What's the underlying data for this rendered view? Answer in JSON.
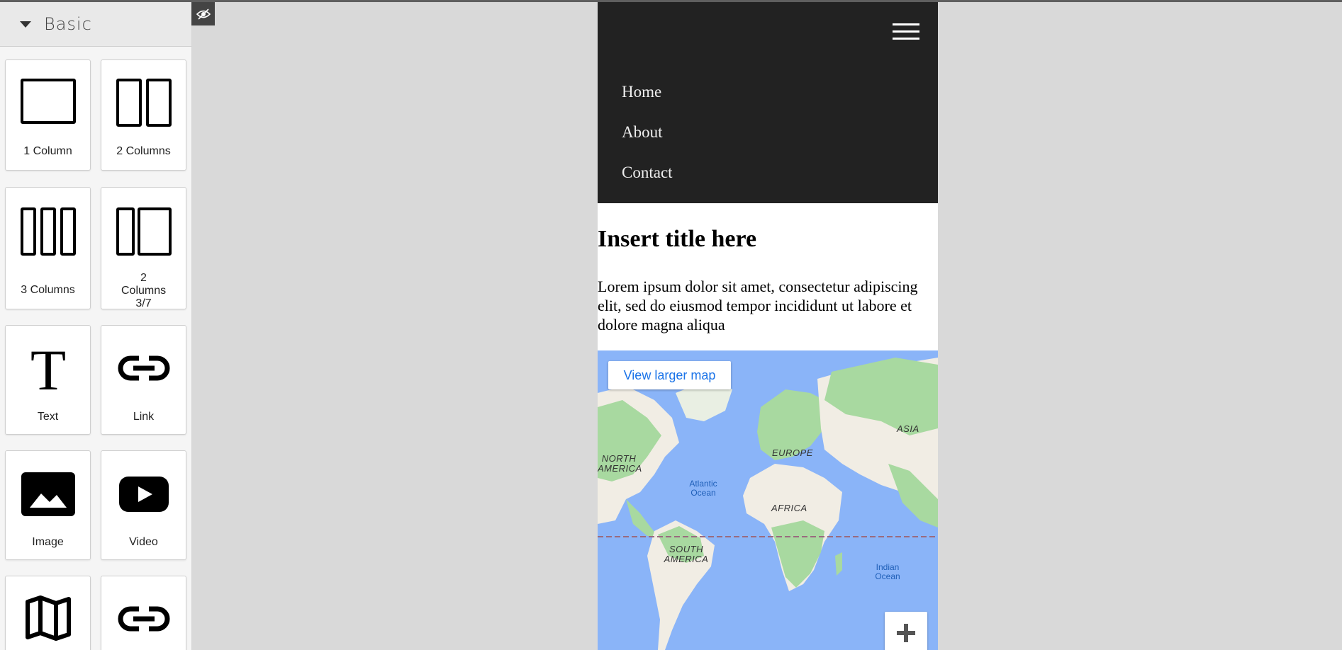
{
  "panel": {
    "title": "Basic",
    "blocks": [
      {
        "label": "1 Column",
        "icon": "one-column-icon"
      },
      {
        "label": "2 Columns",
        "icon": "two-columns-icon"
      },
      {
        "label": "3 Columns",
        "icon": "three-columns-icon"
      },
      {
        "label": "2 Columns 3/7",
        "icon": "two-columns-3-7-icon"
      },
      {
        "label": "Text",
        "icon": "text-icon"
      },
      {
        "label": "Link",
        "icon": "link-icon"
      },
      {
        "label": "Image",
        "icon": "image-icon"
      },
      {
        "label": "Video",
        "icon": "video-icon"
      },
      {
        "label": "",
        "icon": "map-icon"
      },
      {
        "label": "",
        "icon": "link-block-icon"
      }
    ]
  },
  "toolbar": {
    "eye_icon": "eye-slash-icon"
  },
  "page": {
    "nav": {
      "links": [
        "Home",
        "About",
        "Contact"
      ],
      "menu_icon": "hamburger-icon",
      "background": "#222222"
    },
    "title": "Insert title here",
    "paragraph": "Lorem ipsum dolor sit amet, consectetur adipiscing elit, sed do eiusmod tempor incididunt ut labore et dolore magna aliqua",
    "map": {
      "button": "View larger map",
      "continents": [
        "NORTH AMERICA",
        "EUROPE",
        "ASIA",
        "AFRICA",
        "SOUTH AMERICA"
      ],
      "oceans": [
        "Atlantic Ocean",
        "Indian Ocean"
      ],
      "zoom_in_icon": "plus-icon"
    }
  },
  "colors": {
    "canvas_bg": "#d9d9d9",
    "map_water": "#8ab4f8",
    "map_land": "#f1ede4",
    "map_green": "#a8d9a0",
    "link_blue": "#1a73e8"
  }
}
